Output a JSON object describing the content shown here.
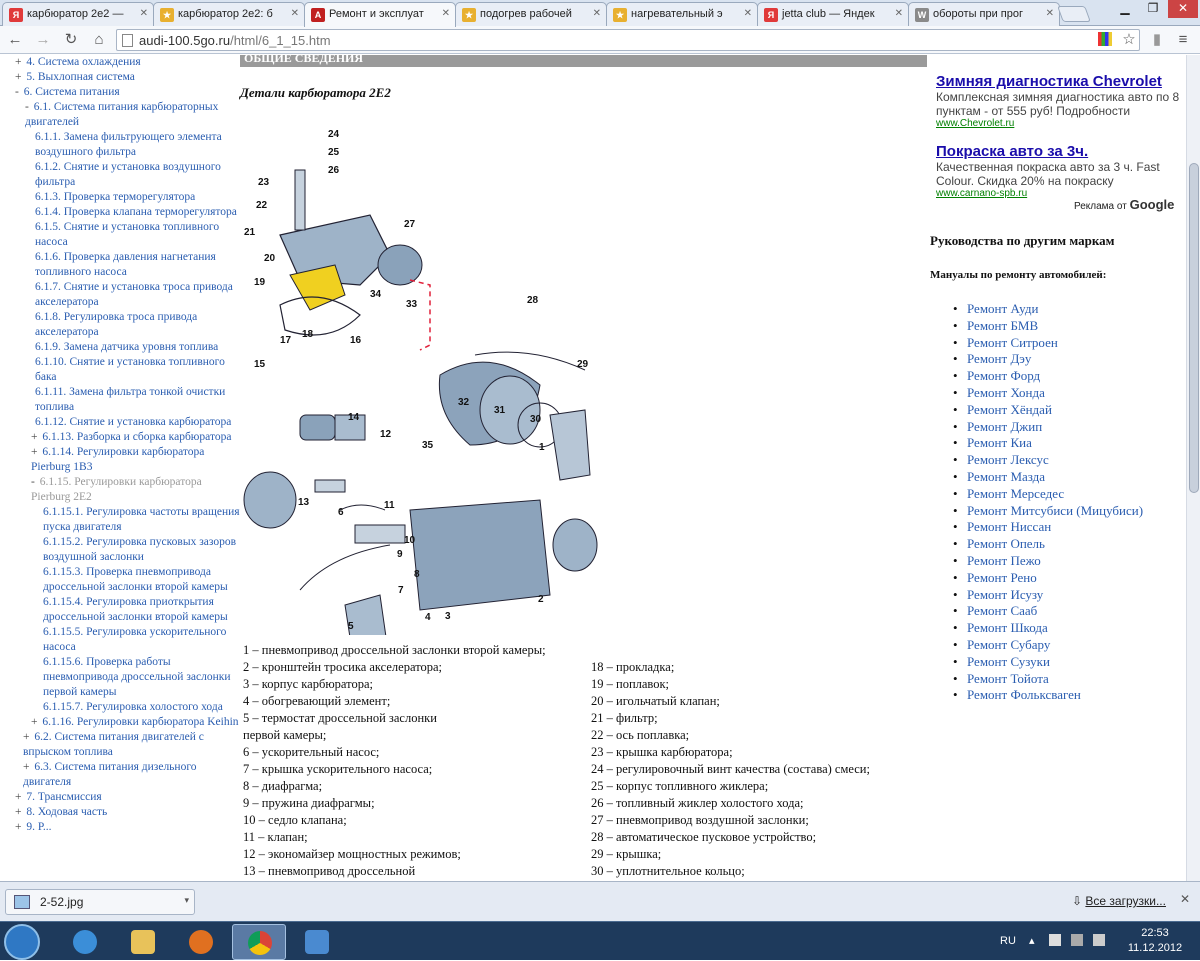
{
  "browser": {
    "tabs": [
      {
        "title": "карбюратор 2е2 —",
        "favicon": "yandex-icon",
        "color": "#e03a3a",
        "glyph": "Я"
      },
      {
        "title": "карбюратор 2е2: б",
        "favicon": "bookmark-icon",
        "color": "#e8b030",
        "glyph": "★"
      },
      {
        "title": "Ремонт и эксплуат",
        "favicon": "audi-icon",
        "color": "#c02020",
        "glyph": "A",
        "active": true
      },
      {
        "title": "подогрев рабочей",
        "favicon": "bookmark-icon",
        "color": "#e8b030",
        "glyph": "★"
      },
      {
        "title": "нагревательный э",
        "favicon": "bookmark-icon",
        "color": "#e8b030",
        "glyph": "★"
      },
      {
        "title": "jetta club — Яндек",
        "favicon": "yandex-icon",
        "color": "#e03a3a",
        "glyph": "Я"
      },
      {
        "title": "обороты при прог",
        "favicon": "vw-icon",
        "color": "#8a8a8a",
        "glyph": "W"
      }
    ],
    "url_host": "audi-100.5go.ru",
    "url_path": "/html/6_1_15.htm"
  },
  "nav": {
    "items": [
      {
        "pm": "+",
        "text": "4. Система охлаждения",
        "indent": 0,
        "state": "link"
      },
      {
        "pm": "+",
        "text": "5. Выхлопная система",
        "indent": 0,
        "state": "link"
      },
      {
        "pm": "-",
        "text": "6. Система питания",
        "indent": 0,
        "state": "link"
      },
      {
        "pm": "-",
        "text": "6.1. Система питания карбюраторных двигателей",
        "indent": 10,
        "state": "link"
      },
      {
        "pm": "",
        "text": "6.1.1. Замена фильтрующего элемента воздушного фильтра",
        "indent": 20,
        "state": "link"
      },
      {
        "pm": "",
        "text": "6.1.2. Снятие и установка воздушного фильтра",
        "indent": 20,
        "state": "link"
      },
      {
        "pm": "",
        "text": "6.1.3. Проверка терморегулятора",
        "indent": 20,
        "state": "link"
      },
      {
        "pm": "",
        "text": "6.1.4. Проверка клапана терморегулятора",
        "indent": 20,
        "state": "link"
      },
      {
        "pm": "",
        "text": "6.1.5. Снятие и установка топливного насоса",
        "indent": 20,
        "state": "link"
      },
      {
        "pm": "",
        "text": "6.1.6. Проверка давления нагнетания топливного насоса",
        "indent": 20,
        "state": "link"
      },
      {
        "pm": "",
        "text": "6.1.7. Снятие и установка троса привода акселератора",
        "indent": 20,
        "state": "link"
      },
      {
        "pm": "",
        "text": "6.1.8. Регулировка троса привода акселератора",
        "indent": 20,
        "state": "link"
      },
      {
        "pm": "",
        "text": "6.1.9. Замена датчика уровня топлива",
        "indent": 20,
        "state": "link"
      },
      {
        "pm": "",
        "text": "6.1.10. Снятие и установка топливного бака",
        "indent": 20,
        "state": "link"
      },
      {
        "pm": "",
        "text": "6.1.11. Замена фильтра тонкой очистки топлива",
        "indent": 20,
        "state": "link"
      },
      {
        "pm": "",
        "text": "6.1.12. Снятие и установка карбюратора",
        "indent": 20,
        "state": "link"
      },
      {
        "pm": "+",
        "text": "6.1.13. Разборка и сборка карбюратора",
        "indent": 16,
        "state": "link"
      },
      {
        "pm": "+",
        "text": "6.1.14. Регулировки карбюратора Pierburg 1B3",
        "indent": 16,
        "state": "link"
      },
      {
        "pm": "-",
        "text": "6.1.15. Регулировки карбюратора Pierburg 2E2",
        "indent": 16,
        "state": "current"
      },
      {
        "pm": "",
        "text": "6.1.15.1. Регулировка частоты вращения пуска двигателя",
        "indent": 28,
        "state": "link"
      },
      {
        "pm": "",
        "text": "6.1.15.2. Регулировка пусковых зазоров воздушной заслонки",
        "indent": 28,
        "state": "link"
      },
      {
        "pm": "",
        "text": "6.1.15.3. Проверка пневмопривода дроссельной заслонки второй камеры",
        "indent": 28,
        "state": "link"
      },
      {
        "pm": "",
        "text": "6.1.15.4. Регулировка приоткрытия дроссельной заслонки второй камеры",
        "indent": 28,
        "state": "link"
      },
      {
        "pm": "",
        "text": "6.1.15.5. Регулировка ускорительного насоса",
        "indent": 28,
        "state": "link"
      },
      {
        "pm": "",
        "text": "6.1.15.6. Проверка работы пневмопривода дроссельной заслонки первой камеры",
        "indent": 28,
        "state": "link"
      },
      {
        "pm": "",
        "text": "6.1.15.7. Регулировка холостого хода",
        "indent": 28,
        "state": "link"
      },
      {
        "pm": "+",
        "text": "6.1.16. Регулировки карбюратора Keihin",
        "indent": 16,
        "state": "link"
      },
      {
        "pm": "+",
        "text": "6.2. Система питания двигателей с впрыском топлива",
        "indent": 8,
        "state": "link"
      },
      {
        "pm": "+",
        "text": "6.3. Система питания дизельного двигателя",
        "indent": 8,
        "state": "link"
      },
      {
        "pm": "+",
        "text": "7. Трансмиссия",
        "indent": 0,
        "state": "link"
      },
      {
        "pm": "+",
        "text": "8. Ходовая часть",
        "indent": 0,
        "state": "link"
      },
      {
        "pm": "+",
        "text": "9. Р...",
        "indent": 0,
        "state": "link"
      }
    ]
  },
  "content": {
    "section_bar": "ОБЩИЕ СВЕДЕНИЯ",
    "title": "Детали карбюратора 2Е2",
    "legend_left": [
      "1 – пневмопривод дроссельной заслонки второй камеры;",
      "2 – кронштейн тросика акселератора;",
      "3 – корпус карбюратора;",
      "4 – обогревающий элемент;",
      "5 – термостат дроссельной заслонки",
      "первой камеры;",
      "6 – ускорительный насос;",
      "7 – крышка ускорительного насоса;",
      "8 – диафрагма;",
      "9 – пружина диафрагмы;",
      "10 – седло клапана;",
      "11 – клапан;",
      "12 – экономайзер мощностных режимов;",
      "13 – пневмопривод дроссельной"
    ],
    "legend_right": [
      "18 – прокладка;",
      "19 – поплавок;",
      "20 – игольчатый клапан;",
      "21 – фильтр;",
      "22 – ось поплавка;",
      "23 – крышка карбюратора;",
      "24 – регулировочный винт качества (состава) смеси;",
      "25 – корпус топливного жиклера;",
      "26 – топливный жиклер холостого хода;",
      "27 – пневмопривод воздушной заслонки;",
      "28 – автоматическое пусковое устройство;",
      "29 – крышка;",
      "30 – уплотнительное кольцо;"
    ],
    "diagram_numbers": [
      "24",
      "25",
      "26",
      "23",
      "22",
      "21",
      "27",
      "20",
      "19",
      "34",
      "33",
      "18",
      "28",
      "17",
      "16",
      "15",
      "29",
      "32",
      "31",
      "30",
      "14",
      "12",
      "1",
      "35",
      "13",
      "11",
      "6",
      "10",
      "9",
      "8",
      "7",
      "2",
      "4",
      "3",
      "5"
    ]
  },
  "ads": [
    {
      "title": "Зимняя диагностика Chevrolet",
      "desc": "Комплексная зимняя диагностика авто по 8 пунктам - от 555 руб! Подробности",
      "url": "www.Chevrolet.ru"
    },
    {
      "title": "Покраска авто за 3ч.",
      "desc": "Качественная покраска авто за 3 ч. Fast Colour. Скидка 20% на покраску",
      "url": "www.carnano-spb.ru"
    }
  ],
  "ads_by": "Реклама от",
  "ads_by_brand": "Google",
  "right": {
    "heading": "Руководства по другим маркам",
    "subheading": "Мануалы по ремонту автомобилей:",
    "brands": [
      "Ремонт Ауди",
      "Ремонт БМВ",
      "Ремонт Ситроен",
      "Ремонт Дэу",
      "Ремонт Форд",
      "Ремонт Хонда",
      "Ремонт Хёндай",
      "Ремонт Джип",
      "Ремонт Киа",
      "Ремонт Лексус",
      "Ремонт Мазда",
      "Ремонт Мерседес",
      "Ремонт Митсубиси (Мицубиси)",
      "Ремонт Ниссан",
      "Ремонт Опель",
      "Ремонт Пежо",
      "Ремонт Рено",
      "Ремонт Исузу",
      "Ремонт Сааб",
      "Ремонт Шкода",
      "Ремонт Субару",
      "Ремонт Сузуки",
      "Ремонт Тойота",
      "Ремонт Фольксваген"
    ]
  },
  "downloads": {
    "file": "2-52.jpg",
    "all": "Все загрузки..."
  },
  "taskbar": {
    "lang": "RU",
    "time": "22:53",
    "date": "11.12.2012"
  }
}
